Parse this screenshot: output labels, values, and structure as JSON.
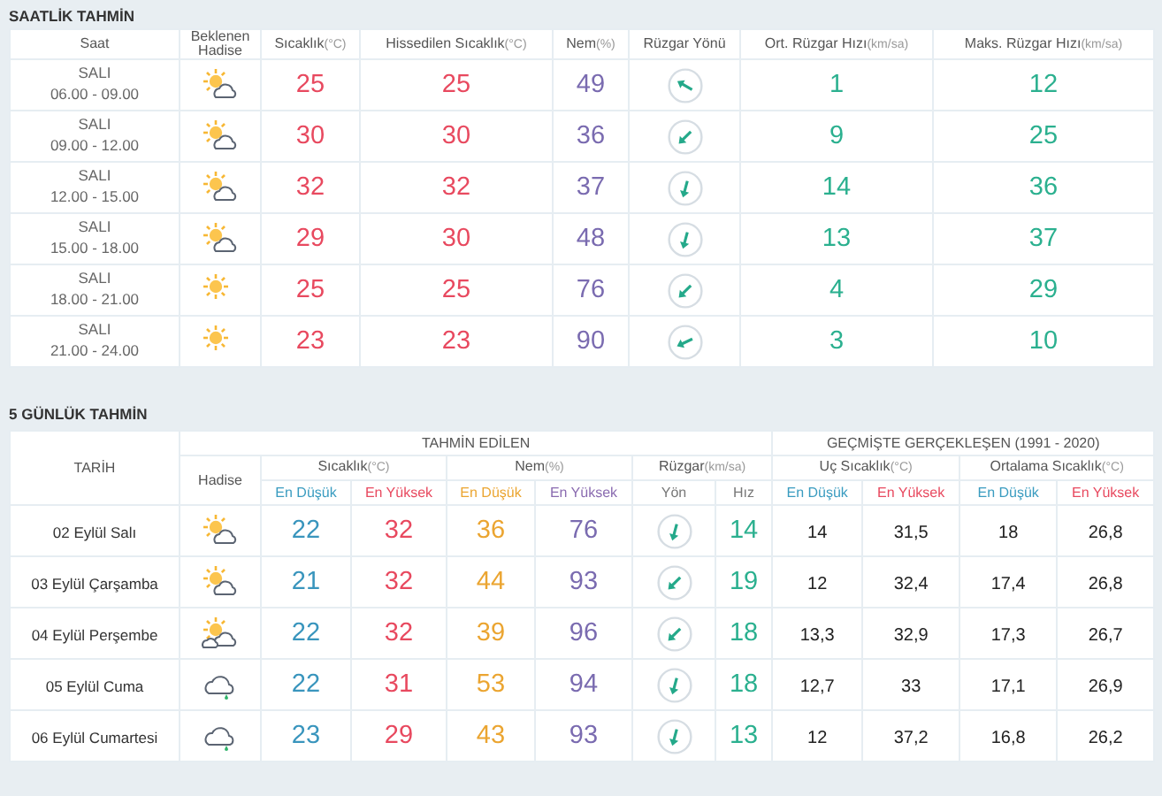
{
  "hourly": {
    "title": "SAATLİK TAHMİN",
    "columns": [
      {
        "label": "Saat"
      },
      {
        "label": "Beklenen Hadise"
      },
      {
        "label": "Sıcaklık",
        "unit": "(°C)"
      },
      {
        "label": "Hissedilen Sıcaklık",
        "unit": "(°C)"
      },
      {
        "label": "Nem",
        "unit": "(%)"
      },
      {
        "label": "Rüzgar Yönü"
      },
      {
        "label": "Ort. Rüzgar Hızı",
        "unit": "(km/sa)"
      },
      {
        "label": "Maks. Rüzgar Hızı",
        "unit": "(km/sa)"
      }
    ],
    "rows": [
      {
        "day": "SALI",
        "time": "06.00 - 09.00",
        "weather": {
          "kind": "suncloud"
        },
        "temp": "25",
        "feels": "25",
        "humidity": "49",
        "wind_arrow": {
          "kind": "northwest"
        },
        "wind_avg": "1",
        "wind_max": "12"
      },
      {
        "day": "SALI",
        "time": "09.00 - 12.00",
        "weather": {
          "kind": "suncloud"
        },
        "temp": "30",
        "feels": "30",
        "humidity": "36",
        "wind_arrow": {
          "kind": "southwest"
        },
        "wind_avg": "9",
        "wind_max": "25"
      },
      {
        "day": "SALI",
        "time": "12.00 - 15.00",
        "weather": {
          "kind": "suncloud"
        },
        "temp": "32",
        "feels": "32",
        "humidity": "37",
        "wind_arrow": {
          "kind": "south"
        },
        "wind_avg": "14",
        "wind_max": "36"
      },
      {
        "day": "SALI",
        "time": "15.00 - 18.00",
        "weather": {
          "kind": "suncloud"
        },
        "temp": "29",
        "feels": "30",
        "humidity": "48",
        "wind_arrow": {
          "kind": "south"
        },
        "wind_avg": "13",
        "wind_max": "37"
      },
      {
        "day": "SALI",
        "time": "18.00 - 21.00",
        "weather": {
          "kind": "sun"
        },
        "temp": "25",
        "feels": "25",
        "humidity": "76",
        "wind_arrow": {
          "kind": "southwest"
        },
        "wind_avg": "4",
        "wind_max": "29"
      },
      {
        "day": "SALI",
        "time": "21.00 - 24.00",
        "weather": {
          "kind": "sun"
        },
        "temp": "23",
        "feels": "23",
        "humidity": "90",
        "wind_arrow": {
          "kind": "westsouthwest"
        },
        "wind_avg": "3",
        "wind_max": "10"
      }
    ]
  },
  "daily": {
    "title": "5 GÜNLÜK TAHMİN",
    "date_header": "TARİH",
    "weather_header": "Hadise",
    "forecast_group": "TAHMİN EDİLEN",
    "past_group": "GEÇMİŞTE GERÇEKLEŞEN (1991 - 2020)",
    "subgroups": [
      {
        "label": "Sıcaklık",
        "unit": "(°C)"
      },
      {
        "label": "Nem",
        "unit": "(%)"
      },
      {
        "label": "Rüzgar",
        "unit": "(km/sa)"
      },
      {
        "label": "Uç Sıcaklık",
        "unit": "(°C)"
      },
      {
        "label": "Ortalama Sıcaklık",
        "unit": "(°C)"
      }
    ],
    "subcolumns": [
      {
        "label": "En Düşük",
        "kind": "low"
      },
      {
        "label": "En Yüksek",
        "kind": "high"
      },
      {
        "label": "En Düşük",
        "kind": "humlow"
      },
      {
        "label": "En Yüksek",
        "kind": "humhigh"
      },
      {
        "label": "Yön",
        "kind": "plain"
      },
      {
        "label": "Hız",
        "kind": "plain"
      },
      {
        "label": "En Düşük",
        "kind": "low"
      },
      {
        "label": "En Yüksek",
        "kind": "high"
      },
      {
        "label": "En Düşük",
        "kind": "low"
      },
      {
        "label": "En Yüksek",
        "kind": "high"
      }
    ],
    "rows": [
      {
        "date": "02 Eylül Salı",
        "weather": {
          "kind": "suncloud"
        },
        "temp_low": "22",
        "temp_high": "32",
        "hum_low": "36",
        "hum_high": "76",
        "wind_arrow": {
          "kind": "south"
        },
        "wind_speed": "14",
        "ext_low": "14",
        "ext_high": "31,5",
        "avg_low": "18",
        "avg_high": "26,8"
      },
      {
        "date": "03 Eylül Çarşamba",
        "weather": {
          "kind": "suncloud"
        },
        "temp_low": "21",
        "temp_high": "32",
        "hum_low": "44",
        "hum_high": "93",
        "wind_arrow": {
          "kind": "southwest"
        },
        "wind_speed": "19",
        "ext_low": "12",
        "ext_high": "32,4",
        "avg_low": "17,4",
        "avg_high": "26,8"
      },
      {
        "date": "04 Eylül Perşembe",
        "weather": {
          "kind": "sunclouds"
        },
        "temp_low": "22",
        "temp_high": "32",
        "hum_low": "39",
        "hum_high": "96",
        "wind_arrow": {
          "kind": "southwest"
        },
        "wind_speed": "18",
        "ext_low": "13,3",
        "ext_high": "32,9",
        "avg_low": "17,3",
        "avg_high": "26,7"
      },
      {
        "date": "05 Eylül Cuma",
        "weather": {
          "kind": "rain"
        },
        "temp_low": "22",
        "temp_high": "31",
        "hum_low": "53",
        "hum_high": "94",
        "wind_arrow": {
          "kind": "south"
        },
        "wind_speed": "18",
        "ext_low": "12,7",
        "ext_high": "33",
        "avg_low": "17,1",
        "avg_high": "26,9"
      },
      {
        "date": "06 Eylül Cumartesi",
        "weather": {
          "kind": "rain"
        },
        "temp_low": "23",
        "temp_high": "29",
        "hum_low": "43",
        "hum_high": "93",
        "wind_arrow": {
          "kind": "south"
        },
        "wind_speed": "13",
        "ext_low": "12",
        "ext_high": "37,2",
        "avg_low": "16,8",
        "avg_high": "26,2"
      }
    ]
  }
}
